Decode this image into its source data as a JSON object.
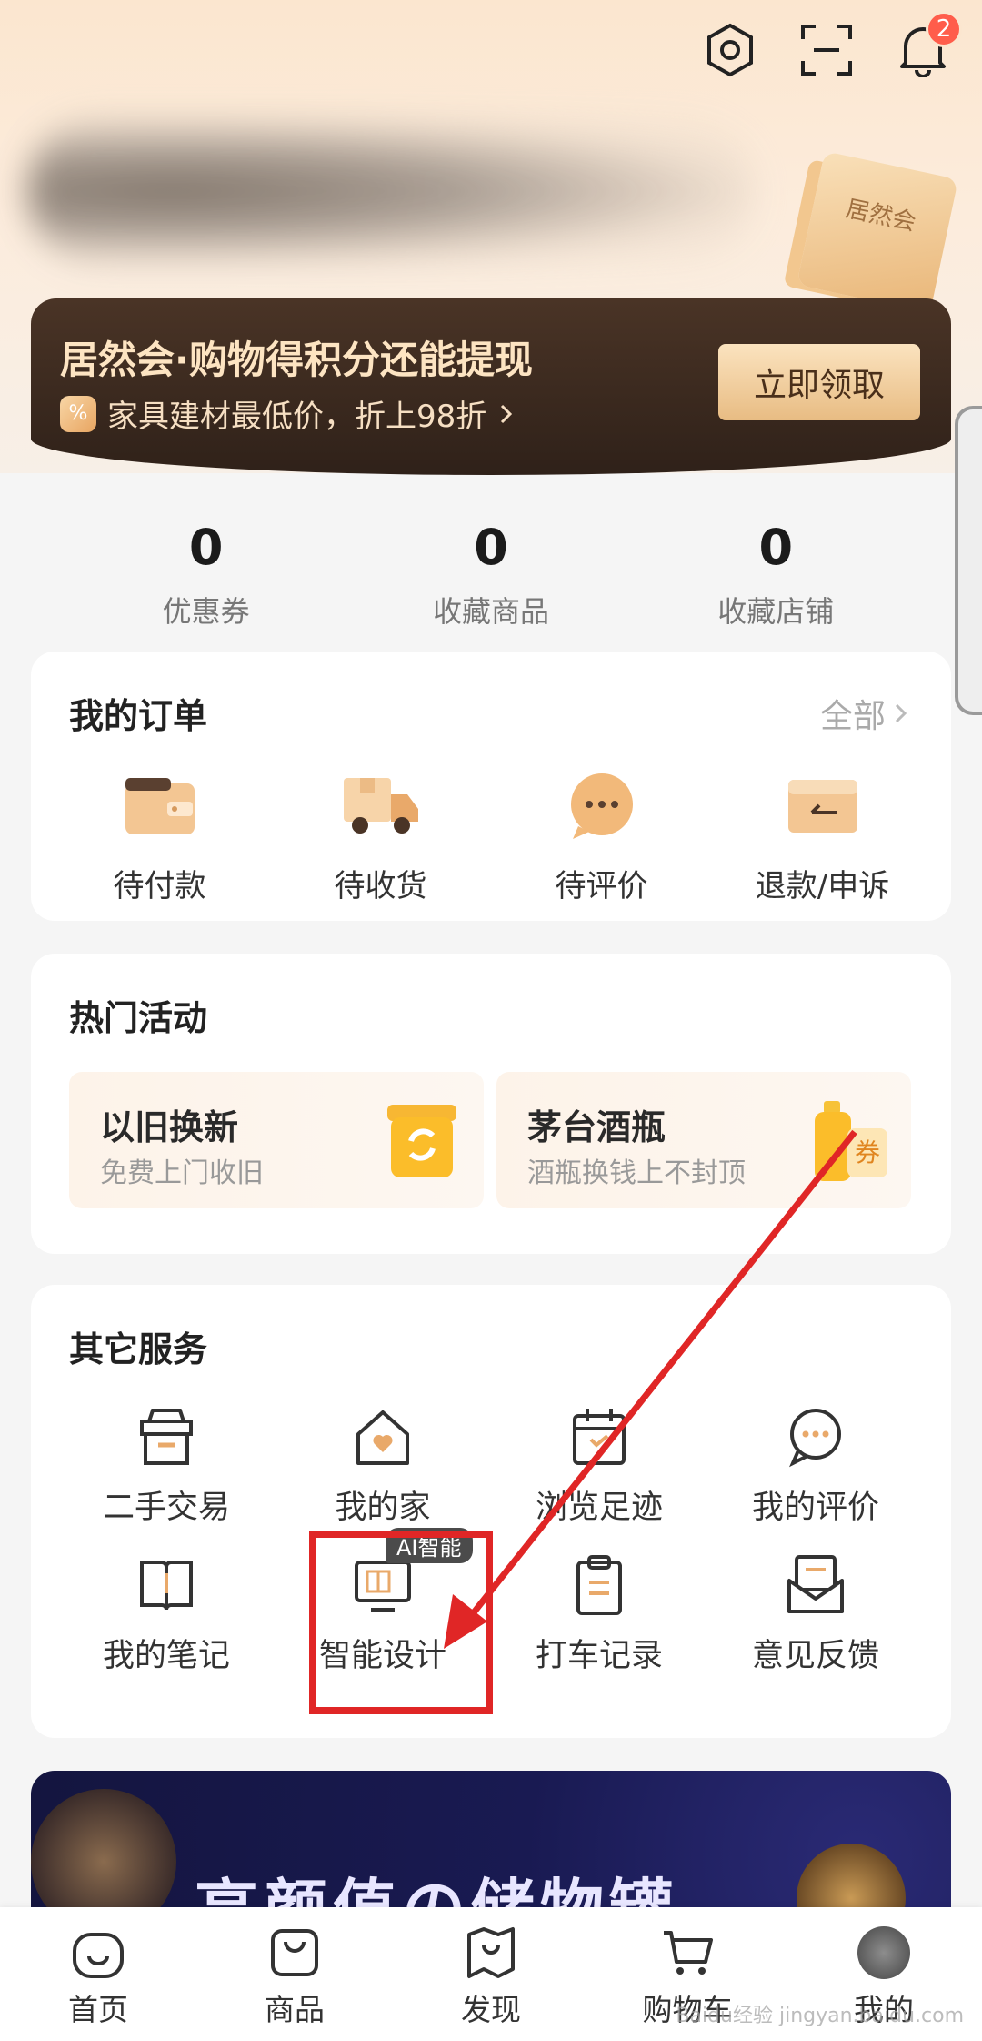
{
  "header": {
    "notification_count": "2",
    "coupon_card_label": "居然会"
  },
  "promo": {
    "title": "居然会·购物得积分还能提现",
    "subtitle": "家具建材最低价，折上98折",
    "percent_icon": "%",
    "button": "立即领取"
  },
  "stats": [
    {
      "value": "0",
      "label": "优惠券"
    },
    {
      "value": "0",
      "label": "收藏商品"
    },
    {
      "value": "0",
      "label": "收藏店铺"
    }
  ],
  "orders": {
    "title": "我的订单",
    "more": "全部",
    "items": [
      {
        "label": "待付款",
        "icon": "wallet-icon"
      },
      {
        "label": "待收货",
        "icon": "truck-icon"
      },
      {
        "label": "待评价",
        "icon": "chat-bubble-icon"
      },
      {
        "label": "退款/申诉",
        "icon": "refund-icon"
      }
    ]
  },
  "activities": {
    "title": "热门活动",
    "items": [
      {
        "title": "以旧换新",
        "subtitle": "免费上门收旧",
        "icon": "recycle-bin-icon"
      },
      {
        "title": "茅台酒瓶",
        "subtitle": "酒瓶换钱上不封顶",
        "icon": "bottle-coupon-icon",
        "icon_text": "券"
      }
    ]
  },
  "services": {
    "title": "其它服务",
    "items": [
      {
        "label": "二手交易",
        "icon": "box-icon"
      },
      {
        "label": "我的家",
        "icon": "home-heart-icon"
      },
      {
        "label": "浏览足迹",
        "icon": "calendar-icon"
      },
      {
        "label": "我的评价",
        "icon": "comment-icon"
      },
      {
        "label": "我的笔记",
        "icon": "book-icon"
      },
      {
        "label": "智能设计",
        "icon": "monitor-icon",
        "tag": "AI智能"
      },
      {
        "label": "打车记录",
        "icon": "clipboard-icon"
      },
      {
        "label": "意见反馈",
        "icon": "envelope-icon"
      }
    ]
  },
  "ad": {
    "text": "高颜值の储物罐"
  },
  "tabbar": [
    {
      "label": "首页",
      "icon": "home-smile-icon"
    },
    {
      "label": "商品",
      "icon": "shopping-bag-icon"
    },
    {
      "label": "发现",
      "icon": "map-icon"
    },
    {
      "label": "购物车",
      "icon": "cart-icon"
    },
    {
      "label": "我的",
      "icon": "avatar-icon"
    }
  ],
  "watermark": "Baidu经验 jingyan.baidu.com",
  "colors": {
    "accent_gold": "#e8bc83",
    "dark_brown": "#3a2a1f",
    "annotation_red": "#e02626"
  }
}
